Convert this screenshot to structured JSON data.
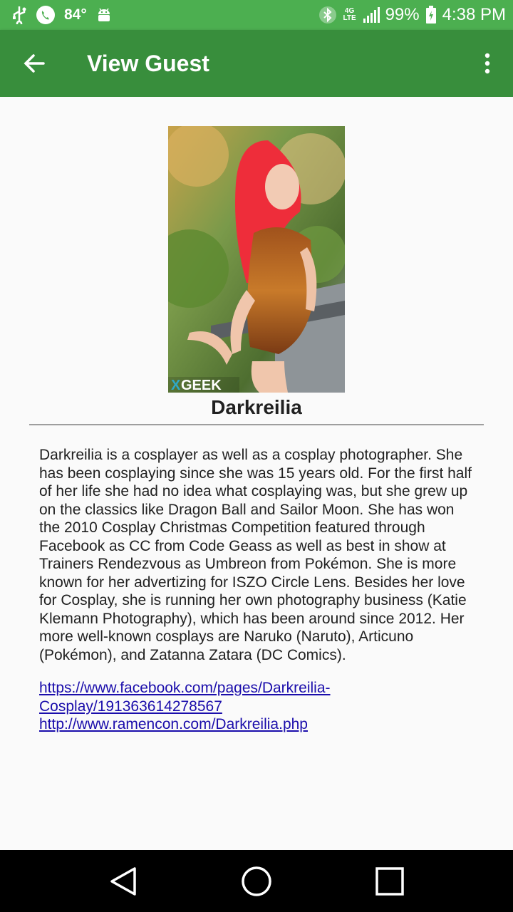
{
  "status_bar": {
    "temperature": "84°",
    "battery": "99%",
    "time": "4:38 PM",
    "network": "4G LTE",
    "icons": [
      "usb-icon",
      "phone-icon",
      "android-icon",
      "bluetooth-icon",
      "signal-icon",
      "battery-icon"
    ]
  },
  "app_bar": {
    "title": "View Guest",
    "color": "#388e3c",
    "status_color": "#4caf50"
  },
  "guest": {
    "name": "Darkreilia",
    "photo_watermark": "GEEK",
    "bio": "Darkreilia is a cosplayer as well as a cosplay photographer. She has been cosplaying since she was 15 years old. For the first half of her life she had no idea what cosplaying was, but she grew up on the classics like Dragon Ball and Sailor Moon. She has won the 2010 Cosplay Christmas Competition featured through Facebook as CC from Code Geass as well as best in show at Trainers Rendezvous as Umbreon from Pokémon. She is more known for her advertizing for ISZO Circle Lens. Besides her love for Cosplay, she is running her own photography business (Katie Klemann Photography), which has been around since 2012. Her more well-known cosplays are Naruko (Naruto), Articuno (Pokémon), and Zatanna Zatara (DC Comics).",
    "links": [
      "https://www.facebook.com/pages/Darkreilia-Cosplay/191363614278567",
      "http://www.ramencon.com/Darkreilia.php"
    ]
  },
  "nav_bar": {
    "buttons": [
      "back-triangle-icon",
      "home-circle-icon",
      "recents-square-icon"
    ]
  }
}
